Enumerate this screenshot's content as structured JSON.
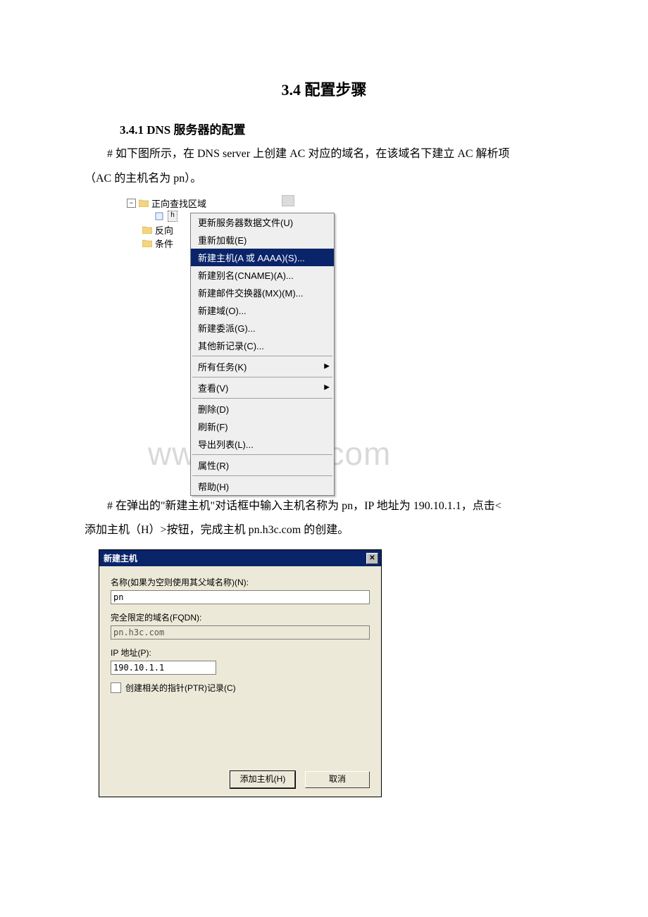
{
  "doc": {
    "section_title": "3.4 配置步骤",
    "subsection": "3.4.1 DNS 服务器的配置",
    "para1_a": "# 如下图所示，在 DNS server 上创建 AC 对应的域名，在该域名下建立 AC 解析项",
    "para1_b": "（AC 的主机名为 pn）。",
    "para2_a": "# 在弹出的\"新建主机\"对话框中输入主机名称为 pn，IP 地址为 190.10.1.1，点击<",
    "para2_b": "添加主机（H）>按钮，完成主机 pn.h3c.com 的创建。"
  },
  "tree": {
    "root": "正向查找区域",
    "sel_abbr": "h",
    "child1": "反向",
    "child2": "条件"
  },
  "menu": {
    "items": [
      {
        "label": "更新服务器数据文件(U)",
        "hl": false
      },
      {
        "label": "重新加载(E)",
        "hl": false
      },
      {
        "label": "新建主机(A 或 AAAA)(S)...",
        "hl": true
      },
      {
        "label": "新建别名(CNAME)(A)...",
        "hl": false
      },
      {
        "label": "新建邮件交换器(MX)(M)...",
        "hl": false
      },
      {
        "label": "新建域(O)...",
        "hl": false
      },
      {
        "label": "新建委派(G)...",
        "hl": false
      },
      {
        "label": "其他新记录(C)...",
        "hl": false
      }
    ],
    "tasks": "所有任务(K)",
    "view": "查看(V)",
    "delete": "删除(D)",
    "refresh": "刷新(F)",
    "export": "导出列表(L)...",
    "props": "属性(R)",
    "help": "帮助(H)"
  },
  "watermark": "www.bdocx.com",
  "dialog": {
    "title": "新建主机",
    "name_label": "名称(如果为空则使用其父域名称)(N):",
    "name_value": "pn",
    "fqdn_label": "完全限定的域名(FQDN):",
    "fqdn_value": "pn.h3c.com",
    "ip_label": "IP 地址(P):",
    "ip_value": "190.10.1.1",
    "ptr_label": "创建相关的指针(PTR)记录(C)",
    "add_btn": "添加主机(H)",
    "cancel_btn": "取消"
  }
}
